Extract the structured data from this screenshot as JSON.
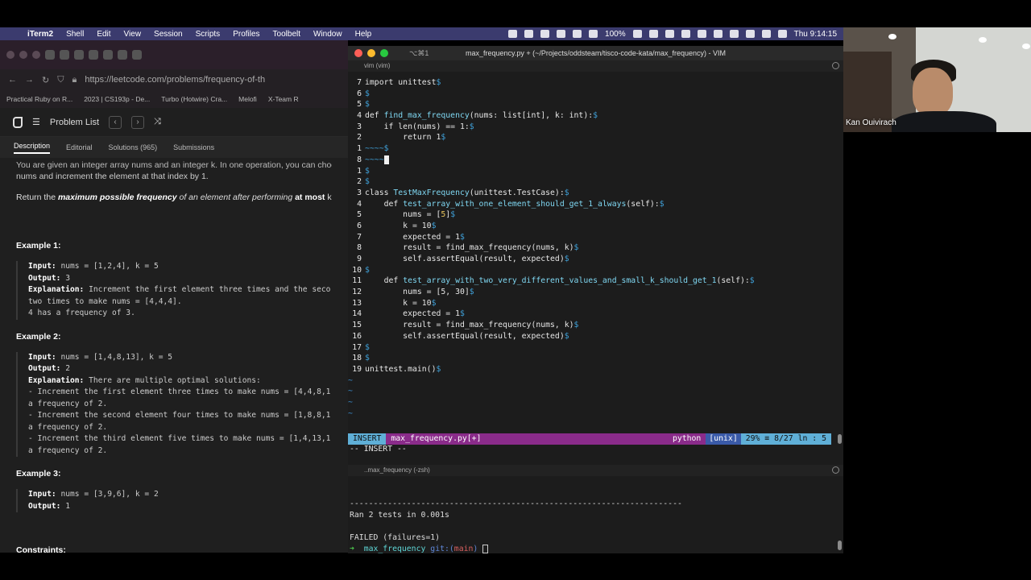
{
  "menubar": {
    "app": "iTerm2",
    "items": [
      "Shell",
      "Edit",
      "View",
      "Session",
      "Scripts",
      "Profiles",
      "Toolbelt",
      "Window",
      "Help"
    ],
    "battery": "100%",
    "clock": "Thu 9:14:15"
  },
  "browser": {
    "url": "https://leetcode.com/problems/frequency-of-th",
    "bookmarks": [
      "Practical Ruby on R...",
      "2023 | CS193p - De...",
      "Turbo (Hotwire) Cra...",
      "Melofi",
      "X-Team R"
    ],
    "nav": {
      "problem_list": "Problem List"
    },
    "tabs": [
      "Description",
      "Editorial",
      "Solutions (965)",
      "Submissions"
    ],
    "intro_line1": "You are given an integer array nums and an integer k. In one operation, you can choose",
    "intro_line2": "nums and increment the element at that index by 1.",
    "return_line_prefix": "Return the ",
    "return_line_bold": "maximum possible frequency",
    "return_line_mid": " of an element after performing ",
    "return_line_bold2": "at most",
    "return_line_suffix": " k o",
    "examples": [
      {
        "title": "Example 1:",
        "input": "nums = [1,2,4], k = 5",
        "output": "3",
        "explanation": "Increment the first element three times and the seco",
        "extra": [
          "two times to make nums = [4,4,4].",
          "4 has a frequency of 3."
        ]
      },
      {
        "title": "Example 2:",
        "input": "nums = [1,4,8,13], k = 5",
        "output": "2",
        "explanation": "There are multiple optimal solutions:",
        "extra": [
          "- Increment the first element three times to make nums = [4,4,8,1",
          "a frequency of 2.",
          "- Increment the second element four times to make nums = [1,8,8,1",
          "a frequency of 2.",
          "- Increment the third element five times to make nums = [1,4,13,1",
          "a frequency of 2."
        ]
      },
      {
        "title": "Example 3:",
        "input": "nums = [3,9,6], k = 2",
        "output": "1"
      }
    ],
    "labels": {
      "input": "Input:",
      "output": "Output:",
      "explanation": "Explanation:"
    },
    "constraints": "Constraints:"
  },
  "iterm": {
    "shortcut": "⌥⌘1",
    "title": "max_frequency.py + (~/Projects/oddsteam/tisco-code-kata/max_frequency) - VIM",
    "vim_pane_label": "vim (vim)",
    "zsh_pane_label": "..max_frequency (-zsh)",
    "status": {
      "mode": "INSERT",
      "file": "max_frequency.py[+]",
      "filetype": "python",
      "fileformat": "[unix]",
      "percent": "29% ≡   8/27 ln :  5"
    },
    "cmdline": "-- INSERT --",
    "zsh": {
      "rule": "----------------------------------------------------------------------",
      "ran": "Ran 2 tests in 0.001s",
      "failed": "FAILED (failures=1)",
      "prompt_dir": "max_frequency",
      "prompt_git": "git:(",
      "prompt_branch": "main",
      "prompt_close": ")"
    }
  },
  "code_lines": [
    {
      "n": "7",
      "parts": [
        [
          "kw",
          "import unittest"
        ],
        [
          "eol",
          "$"
        ]
      ]
    },
    {
      "n": "6",
      "parts": [
        [
          "eol",
          "$"
        ]
      ]
    },
    {
      "n": "5",
      "parts": [
        [
          "eol",
          "$"
        ]
      ]
    },
    {
      "n": "4",
      "parts": [
        [
          "kw",
          "def "
        ],
        [
          "fn",
          "find_max_frequency"
        ],
        [
          "code",
          "(nums: list[int], k: int):"
        ],
        [
          "eol",
          "$"
        ]
      ]
    },
    {
      "n": "3",
      "parts": [
        [
          "code",
          "    if len(nums) == 1:"
        ],
        [
          "eol",
          "$"
        ]
      ]
    },
    {
      "n": "2",
      "parts": [
        [
          "code",
          "        return 1"
        ],
        [
          "eol",
          "$"
        ]
      ]
    },
    {
      "n": "1",
      "parts": [
        [
          "eol",
          "~~~~$"
        ]
      ]
    },
    {
      "n": "8",
      "parts": [
        [
          "eol",
          "~~~~"
        ],
        [
          "cur",
          " "
        ]
      ]
    },
    {
      "n": "1",
      "parts": [
        [
          "eol",
          "$"
        ]
      ]
    },
    {
      "n": "2",
      "parts": [
        [
          "eol",
          "$"
        ]
      ]
    },
    {
      "n": "3",
      "parts": [
        [
          "kw",
          "class "
        ],
        [
          "fn",
          "TestMaxFrequency"
        ],
        [
          "code",
          "(unittest.TestCase):"
        ],
        [
          "eol",
          "$"
        ]
      ]
    },
    {
      "n": "4",
      "parts": [
        [
          "code",
          "    def "
        ],
        [
          "fn",
          "test_array_with_one_element_should_get_1_always"
        ],
        [
          "code",
          "(self):"
        ],
        [
          "eol",
          "$"
        ]
      ]
    },
    {
      "n": "5",
      "parts": [
        [
          "code",
          "        nums = ["
        ],
        [
          "str",
          "5"
        ],
        [
          "code",
          "]"
        ],
        [
          "eol",
          "$"
        ]
      ]
    },
    {
      "n": "6",
      "parts": [
        [
          "code",
          "        k = 10"
        ],
        [
          "eol",
          "$"
        ]
      ]
    },
    {
      "n": "7",
      "parts": [
        [
          "code",
          "        expected = 1"
        ],
        [
          "eol",
          "$"
        ]
      ]
    },
    {
      "n": "8",
      "parts": [
        [
          "code",
          "        result = find_max_frequency(nums, k)"
        ],
        [
          "eol",
          "$"
        ]
      ]
    },
    {
      "n": "9",
      "parts": [
        [
          "code",
          "        self.assertEqual(result, expected)"
        ],
        [
          "eol",
          "$"
        ]
      ]
    },
    {
      "n": "10",
      "parts": [
        [
          "eol",
          "$"
        ]
      ]
    },
    {
      "n": "11",
      "parts": [
        [
          "code",
          "    def "
        ],
        [
          "fn",
          "test_array_with_two_very_different_values_and_small_k_should_get_1"
        ],
        [
          "code",
          "(self):"
        ],
        [
          "eol",
          "$"
        ]
      ]
    },
    {
      "n": "12",
      "parts": [
        [
          "code",
          "        nums = [5, 30]"
        ],
        [
          "eol",
          "$"
        ]
      ]
    },
    {
      "n": "13",
      "parts": [
        [
          "code",
          "        k = 10"
        ],
        [
          "eol",
          "$"
        ]
      ]
    },
    {
      "n": "14",
      "parts": [
        [
          "code",
          "        expected = 1"
        ],
        [
          "eol",
          "$"
        ]
      ]
    },
    {
      "n": "15",
      "parts": [
        [
          "code",
          "        result = find_max_frequency(nums, k)"
        ],
        [
          "eol",
          "$"
        ]
      ]
    },
    {
      "n": "16",
      "parts": [
        [
          "code",
          "        self.assertEqual(result, expected)"
        ],
        [
          "eol",
          "$"
        ]
      ]
    },
    {
      "n": "17",
      "parts": [
        [
          "eol",
          "$"
        ]
      ]
    },
    {
      "n": "18",
      "parts": [
        [
          "eol",
          "$"
        ]
      ]
    },
    {
      "n": "19",
      "parts": [
        [
          "code",
          "unittest.main()"
        ],
        [
          "eol",
          "$"
        ]
      ]
    }
  ],
  "tilde_rows": 4,
  "webcam": {
    "name": "Kan Ouivirach"
  }
}
